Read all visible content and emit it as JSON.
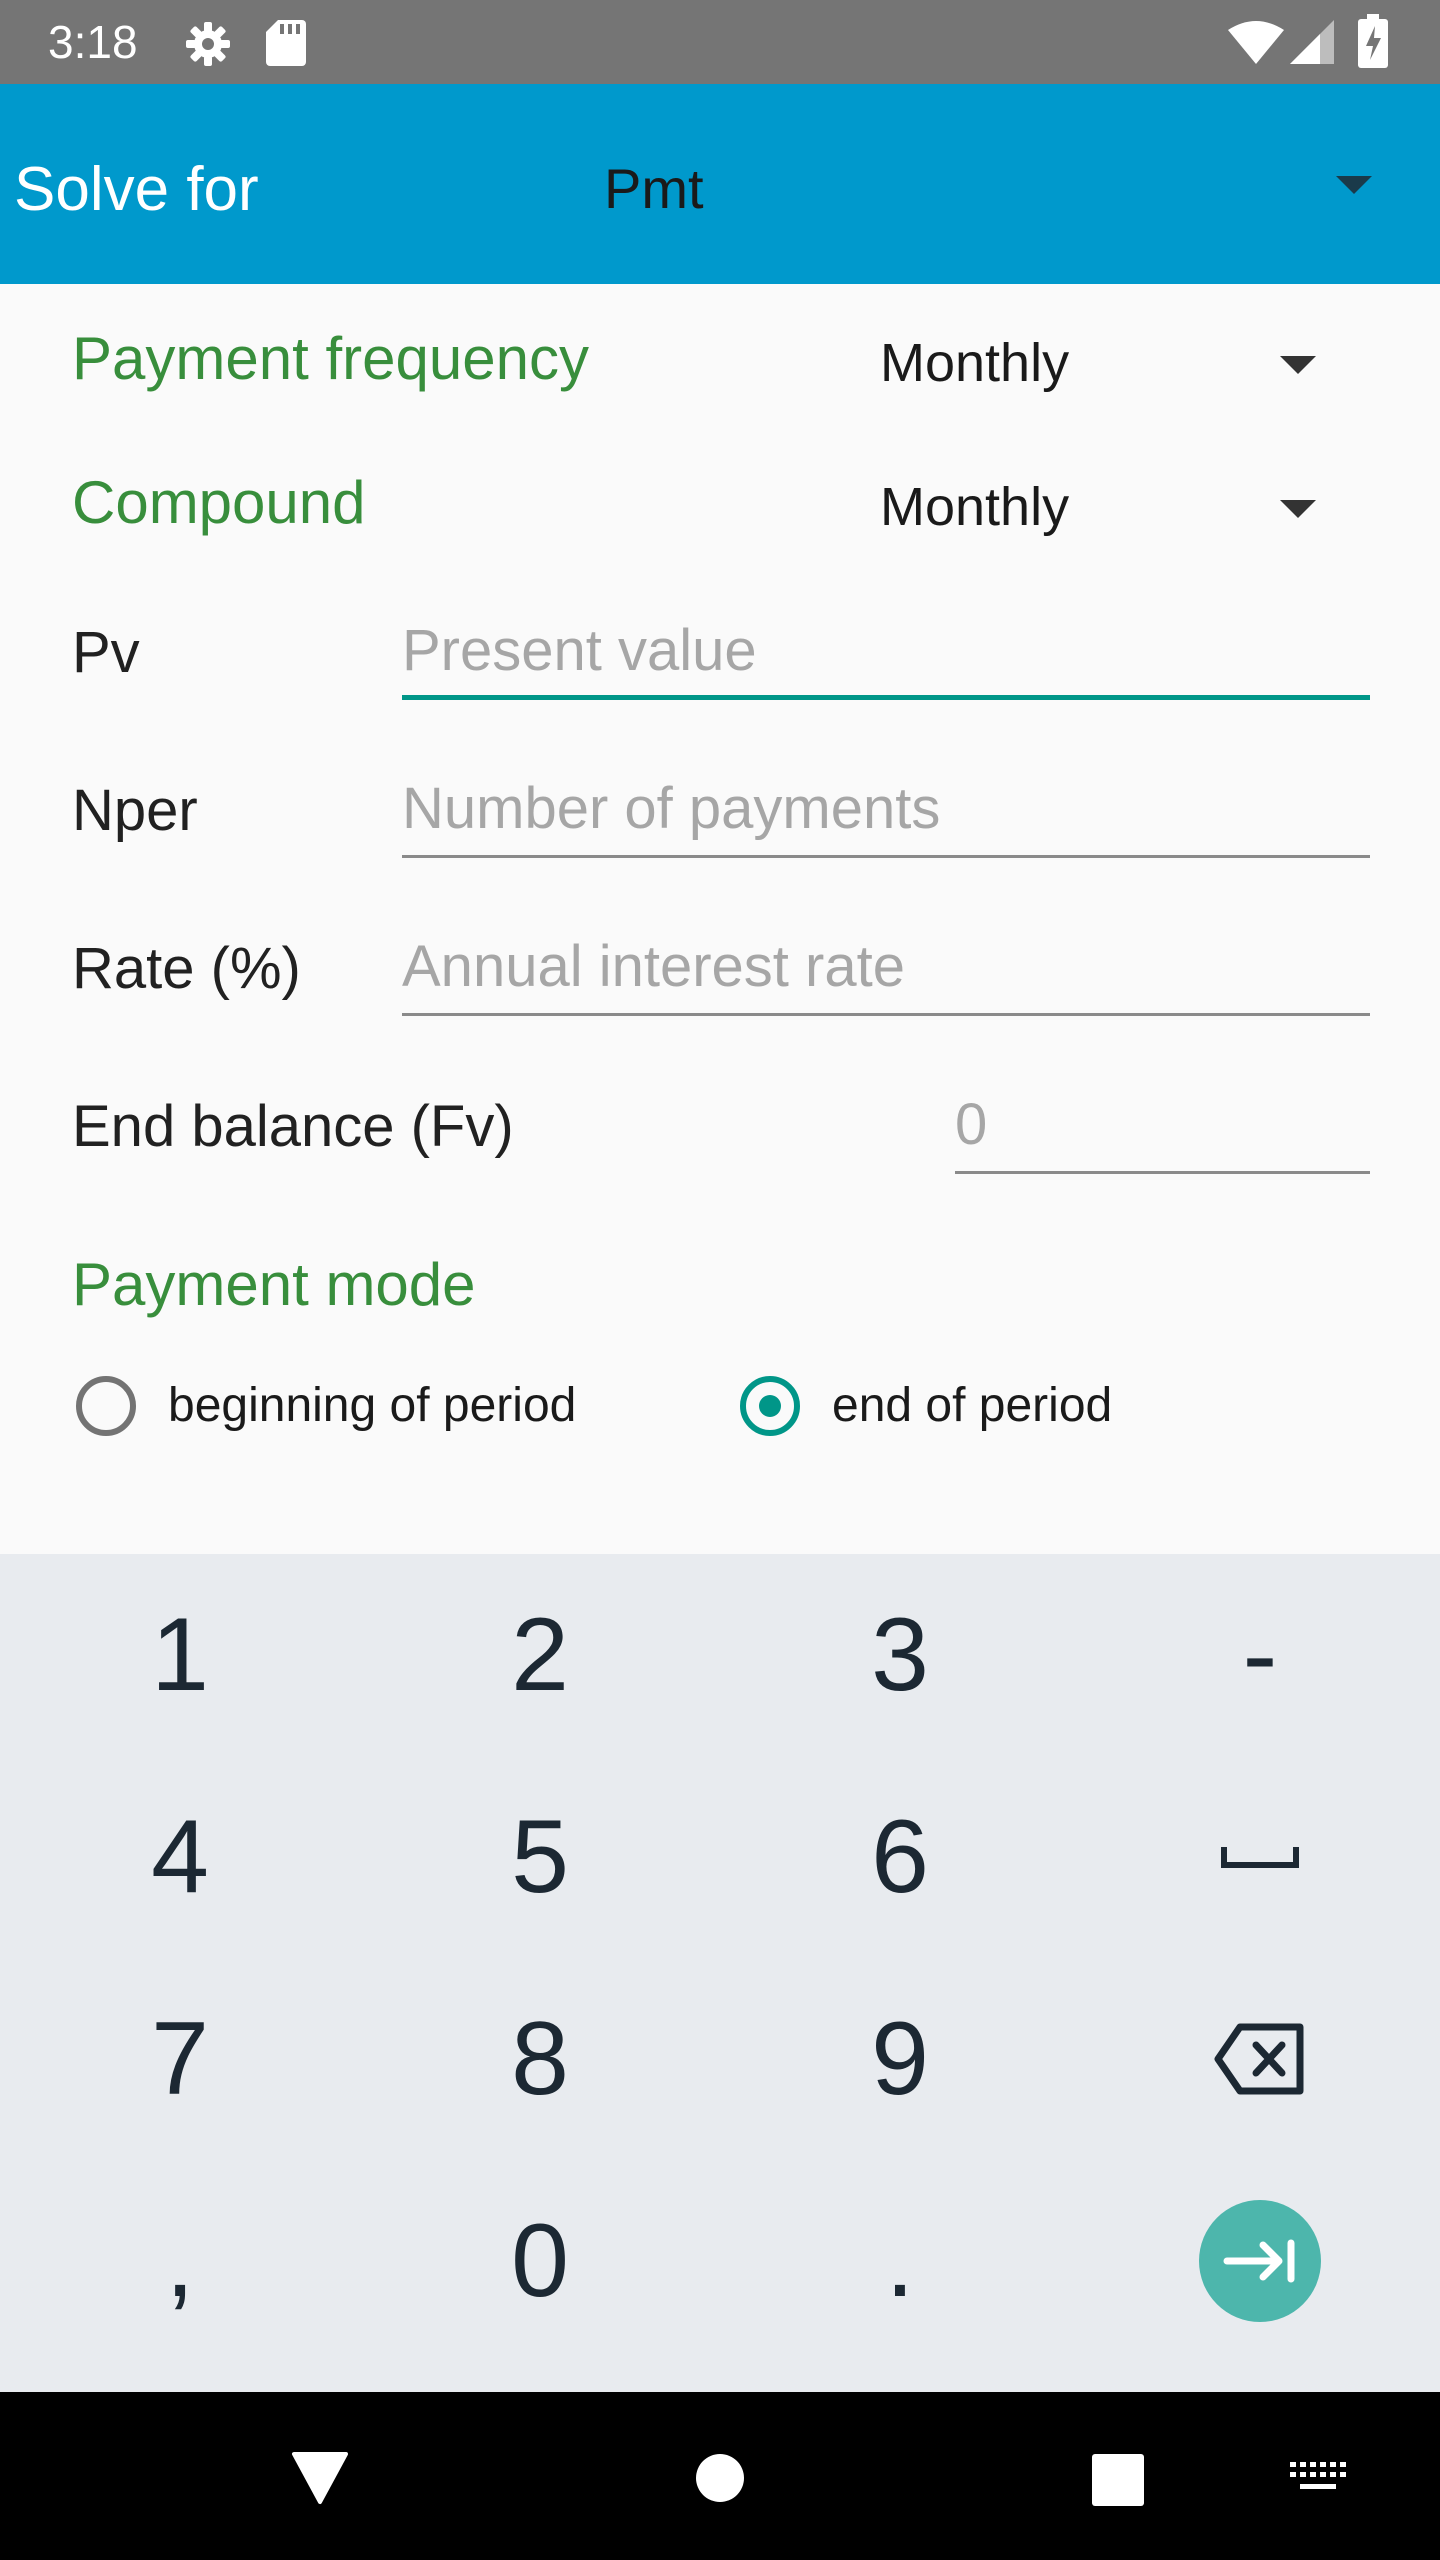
{
  "status_bar": {
    "time": "3:18",
    "left_icons": [
      "gear-icon",
      "sd-card-icon"
    ],
    "right_icons": [
      "wifi-icon",
      "signal-icon",
      "battery-charging-icon"
    ]
  },
  "toolbar": {
    "title": "Solve for",
    "selected": "Pmt",
    "background_color": "#0099cc"
  },
  "form": {
    "payment_frequency": {
      "label": "Payment frequency",
      "value": "Monthly"
    },
    "compound": {
      "label": "Compound",
      "value": "Monthly"
    },
    "pv": {
      "label": "Pv",
      "placeholder": "Present value",
      "value": ""
    },
    "nper": {
      "label": "Nper",
      "placeholder": "Number of payments",
      "value": ""
    },
    "rate": {
      "label": "Rate (%)",
      "placeholder": "Annual interest rate",
      "value": ""
    },
    "fv": {
      "label": "End balance (Fv)",
      "placeholder": "0",
      "value": ""
    },
    "payment_mode": {
      "label": "Payment mode",
      "options": [
        "beginning of period",
        "end of period"
      ],
      "selected": "end of period"
    },
    "accent_color": "#009688",
    "section_label_color": "#388e3c"
  },
  "keyboard": {
    "rows": [
      [
        "1",
        "2",
        "3",
        "-"
      ],
      [
        "4",
        "5",
        "6",
        "space-icon"
      ],
      [
        "7",
        "8",
        "9",
        "backspace-icon"
      ],
      [
        ",",
        "0",
        ".",
        "tab-next-icon"
      ]
    ]
  },
  "nav_bar": {
    "icons": [
      "back-icon",
      "home-icon",
      "recents-icon",
      "keyboard-switch-icon"
    ]
  }
}
